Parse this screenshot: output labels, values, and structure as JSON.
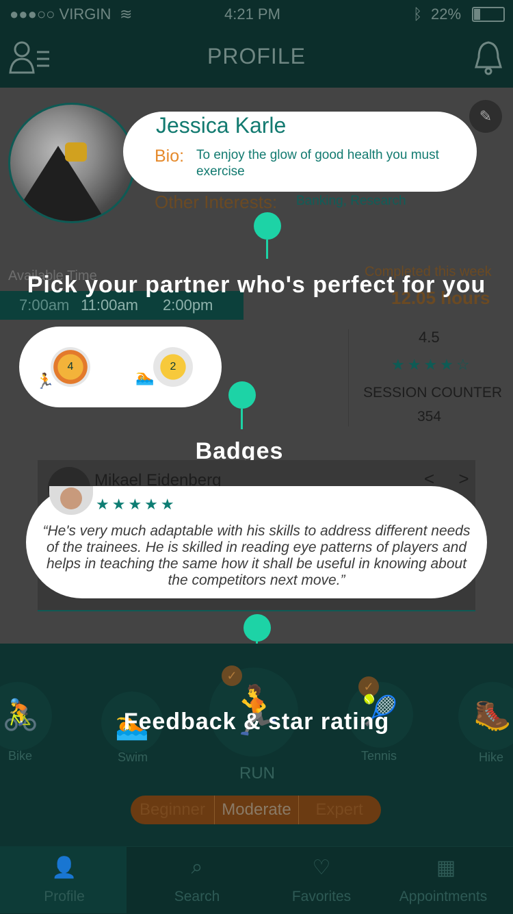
{
  "status_bar": {
    "carrier": "●●●○○ VIRGIN",
    "time": "4:21 PM",
    "battery": "22%"
  },
  "header": {
    "title": "PROFILE"
  },
  "profile": {
    "name": "Jessica Karle",
    "bio_label": "Bio:",
    "bio_text": "To enjoy the glow of good health you must exercise",
    "other_interests_label": "Other Interests:",
    "other_interests_value": "Banking, Research",
    "available_time_label": "Available Time",
    "times": [
      "7:00am",
      "11:00am",
      "2:00pm"
    ],
    "completed_label": "Completed this week",
    "completed_value": "12.05 hours"
  },
  "overlay_tagline": "Pick your partner who's perfect for you",
  "stats": {
    "rating": "4.5",
    "rating_stars": "★★★★☆",
    "session_label": "SESSION COUNTER",
    "session_value": "354"
  },
  "badges": {
    "items": [
      {
        "count": "4",
        "activity": "run"
      },
      {
        "count": "2",
        "activity": "swim"
      }
    ],
    "label": "Badges"
  },
  "review": {
    "reviewer": "Mikael Eidenberg",
    "stars": "★★★★★",
    "quote": "“He's very much adaptable with his skills to address different needs of the trainees. He is skilled in reading eye patterns of players and helps in teaching the same how it shall be useful in knowing about the competitors next move.”",
    "arrows": "< >"
  },
  "feedback_label": "Feedback & star rating",
  "activities": {
    "items": [
      "Bike",
      "Swim",
      "Tennis",
      "Hike"
    ],
    "selected": "RUN",
    "levels": [
      "Beginner",
      "Moderate",
      "Expert"
    ],
    "selected_level": "Moderate"
  },
  "tabbar": {
    "tabs": [
      "Profile",
      "Search",
      "Favorites",
      "Appointments"
    ]
  },
  "colors": {
    "accent": "#1dd3a6",
    "teal": "#127a70",
    "orange": "#e58a2c"
  }
}
